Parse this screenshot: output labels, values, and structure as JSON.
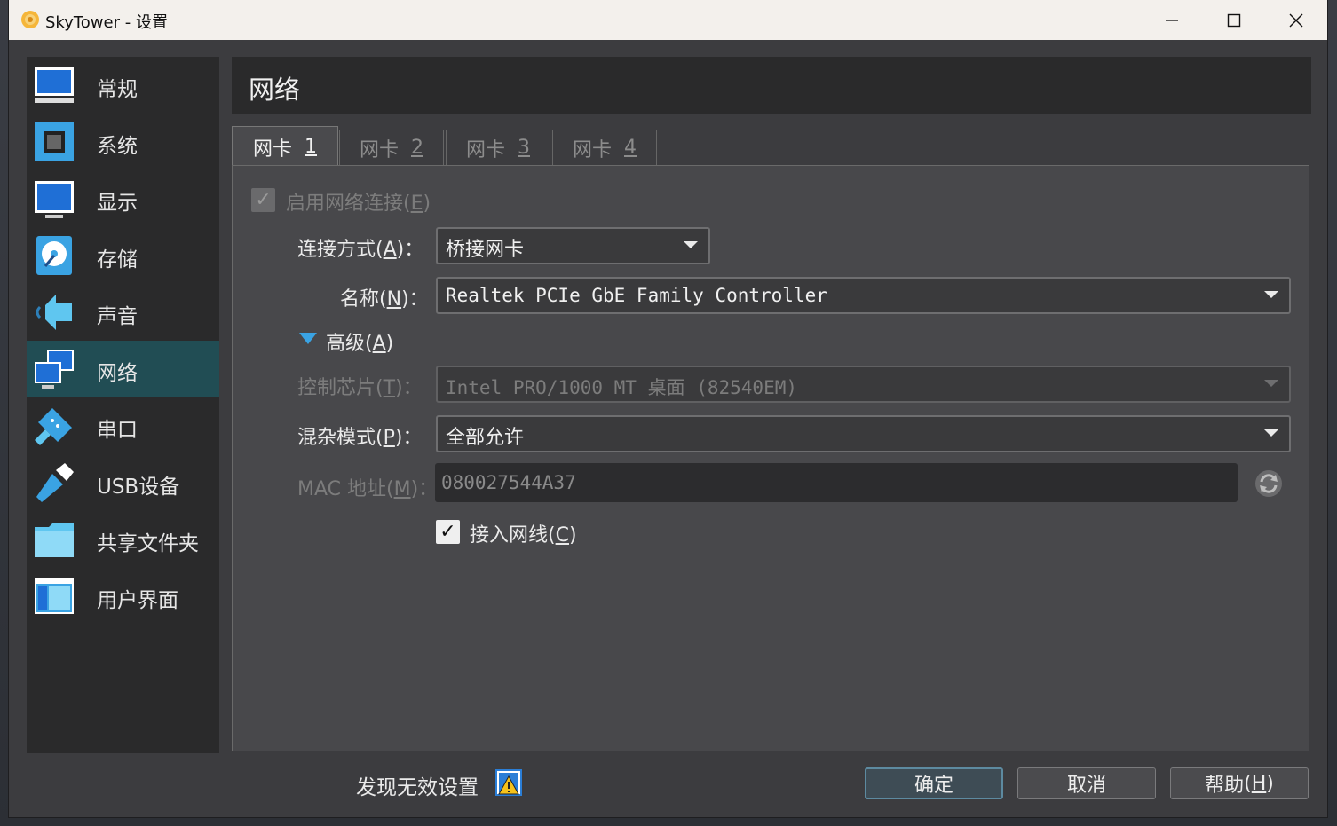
{
  "window": {
    "title": "SkyTower - 设置"
  },
  "sidebar": {
    "items": [
      {
        "label": "常规",
        "icon": "general-icon"
      },
      {
        "label": "系统",
        "icon": "system-icon"
      },
      {
        "label": "显示",
        "icon": "display-icon"
      },
      {
        "label": "存储",
        "icon": "storage-icon"
      },
      {
        "label": "声音",
        "icon": "audio-icon"
      },
      {
        "label": "网络",
        "icon": "network-icon",
        "active": true
      },
      {
        "label": "串口",
        "icon": "serial-port-icon"
      },
      {
        "label": "USB设备",
        "icon": "usb-icon"
      },
      {
        "label": "共享文件夹",
        "icon": "shared-folder-icon"
      },
      {
        "label": "用户界面",
        "icon": "user-interface-icon"
      }
    ]
  },
  "header": {
    "title": "网络"
  },
  "tabs": [
    {
      "label": "网卡",
      "num": "1",
      "active": true
    },
    {
      "label": "网卡",
      "num": "2"
    },
    {
      "label": "网卡",
      "num": "3"
    },
    {
      "label": "网卡",
      "num": "4"
    }
  ],
  "form": {
    "enable": {
      "text": "启用网络连接",
      "accel": "E",
      "checked": true,
      "disabled": true
    },
    "attached": {
      "label": "连接方式",
      "accel": "A",
      "value": "桥接网卡"
    },
    "name": {
      "label": "名称",
      "accel": "N",
      "value": "Realtek PCIe GbE Family Controller"
    },
    "advanced": {
      "label": "高级",
      "accel": "A"
    },
    "adapter": {
      "label": "控制芯片",
      "accel": "T",
      "value": "Intel PRO/1000 MT 桌面 (82540EM)",
      "disabled": true
    },
    "promisc": {
      "label": "混杂模式",
      "accel": "P",
      "value": "全部允许"
    },
    "mac": {
      "label": "MAC 地址",
      "accel": "M",
      "value": "080027544A37",
      "disabled": true
    },
    "cable": {
      "text": "接入网线",
      "accel": "C",
      "checked": true
    }
  },
  "footer": {
    "warning": "发现无效设置",
    "ok": "确定",
    "cancel": "取消",
    "help": "帮助",
    "help_accel": "H"
  },
  "colors": {
    "accent": "#3aa3e3",
    "active_item": "#214d54",
    "background": "#3c3c3f"
  }
}
